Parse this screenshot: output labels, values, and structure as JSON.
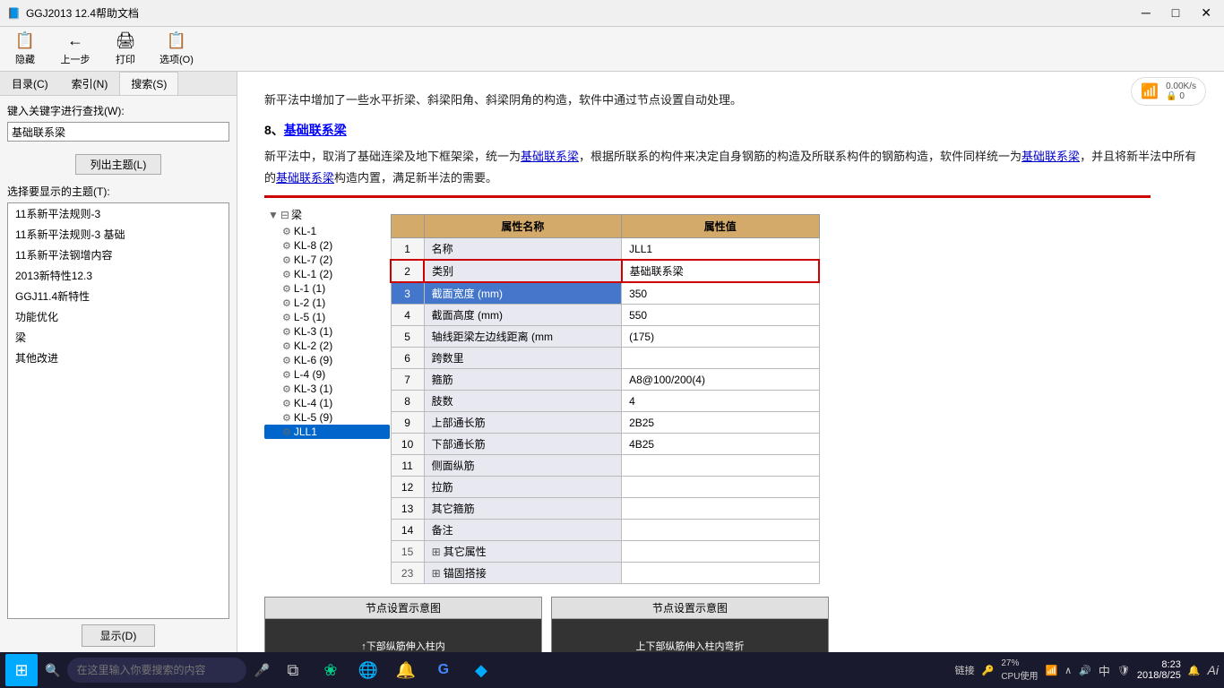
{
  "titleBar": {
    "title": "GGJ2013 12.4帮助文档",
    "controls": [
      "─",
      "□",
      "✕"
    ]
  },
  "toolbar": {
    "buttons": [
      {
        "id": "hide",
        "icon": "📋",
        "label": "隐藏"
      },
      {
        "id": "back",
        "icon": "←",
        "label": "上一步"
      },
      {
        "id": "print",
        "icon": "🖨",
        "label": "打印"
      },
      {
        "id": "options",
        "icon": "📋",
        "label": "选项(O)"
      }
    ]
  },
  "leftPanel": {
    "tabs": [
      {
        "id": "catalog",
        "label": "目录(C)"
      },
      {
        "id": "index",
        "label": "索引(N)"
      },
      {
        "id": "search",
        "label": "搜索(S)",
        "active": true
      }
    ],
    "searchLabel": "键入关键字进行查找(W):",
    "searchValue": "基础联系梁",
    "listTopicBtn": "列出主题(L)",
    "topicSelectLabel": "选择要显示的主题(T):",
    "topics": [
      "11系新平法规则-3",
      "11系新平法规则-3 基础",
      "11系新平法钢增内容",
      "2013新特性12.3",
      "GGJ11.4新特性",
      "功能优化",
      "梁",
      "其他改进"
    ],
    "showBtn": "显示(D)"
  },
  "content": {
    "introText": "新平法中增加了一些水平折梁、斜梁阳角、斜梁阴角的构造，软件中通过节点设置自动处理。",
    "sectionNum": "8、",
    "sectionTitle": "基础联系梁",
    "bodyText1": "新平法中，取消了基础连梁及地下框架梁，统一为",
    "link1": "基础联系梁",
    "bodyText2": "，根据所联系的构件来决定自身钢筋的构造及所联系构件的钢筋构造，软件同样统一为",
    "link2": "基础联系梁",
    "bodyText3": "，并且将新半法中所有的",
    "link3": "基础联系梁",
    "bodyText4": "构造内置，满足新半法的需要。",
    "network": {
      "speed": "0.00K/s",
      "count": "0"
    },
    "table": {
      "headers": [
        "属性名称",
        "属性值"
      ],
      "rows": [
        {
          "num": "1",
          "name": "名称",
          "value": "JLL1",
          "nameLink": true
        },
        {
          "num": "2",
          "name": "类别",
          "value": "基础联系梁",
          "redBorder": true
        },
        {
          "num": "3",
          "name": "截面宽度 (mm)",
          "value": "350",
          "selected": true
        },
        {
          "num": "4",
          "name": "截面高度 (mm)",
          "value": "550"
        },
        {
          "num": "5",
          "name": "轴线距梁左边线距离 (mm",
          "value": "(175)"
        },
        {
          "num": "6",
          "name": "跨数里",
          "value": ""
        },
        {
          "num": "7",
          "name": "箍筋",
          "value": "A8@100/200(4)"
        },
        {
          "num": "8",
          "name": "肢数",
          "value": "4"
        },
        {
          "num": "9",
          "name": "上部通长筋",
          "value": "2B25"
        },
        {
          "num": "10",
          "name": "下部通长筋",
          "value": "4B25"
        },
        {
          "num": "11",
          "name": "侧面纵筋",
          "value": "",
          "nameLink": true
        },
        {
          "num": "12",
          "name": "拉筋",
          "value": "",
          "nameLink": true
        },
        {
          "num": "13",
          "name": "其它箍筋",
          "value": "",
          "nameLink": true
        },
        {
          "num": "14",
          "name": "备注",
          "value": ""
        },
        {
          "num": "15",
          "name": "其它属性",
          "value": "",
          "expand": true
        },
        {
          "num": "23",
          "name": "锚固搭接",
          "value": "",
          "expand": true
        }
      ]
    },
    "tree": {
      "root": "梁",
      "items": [
        {
          "label": "KL-1",
          "indent": 1
        },
        {
          "label": "KL-8 (2)",
          "indent": 1
        },
        {
          "label": "KL-7 (2)",
          "indent": 1
        },
        {
          "label": "KL-1 (2)",
          "indent": 1
        },
        {
          "label": "L-1 (1)",
          "indent": 1
        },
        {
          "label": "L-2 (1)",
          "indent": 1
        },
        {
          "label": "L-5 (1)",
          "indent": 1
        },
        {
          "label": "KL-3 (1)",
          "indent": 1
        },
        {
          "label": "KL-2 (2)",
          "indent": 1
        },
        {
          "label": "KL-6 (9)",
          "indent": 1
        },
        {
          "label": "L-4 (9)",
          "indent": 1
        },
        {
          "label": "KL-3 (1)",
          "indent": 1
        },
        {
          "label": "KL-4 (1)",
          "indent": 1
        },
        {
          "label": "KL-5 (9)",
          "indent": 1
        },
        {
          "label": "JLL1",
          "indent": 1,
          "selected": true
        }
      ]
    },
    "bottomPanels": [
      {
        "title": "节点设置示意图",
        "label": "↑下部纵筋伸入柱内"
      },
      {
        "title": "节点设置示意图",
        "label": "上下部纵筋伸入柱内弯折"
      }
    ]
  },
  "taskbar": {
    "searchPlaceholder": "在这里输入你要搜索的内容",
    "apps": [
      "⊞",
      "🔍",
      "🔄",
      "🌐",
      "🔔",
      "G",
      "🔷"
    ],
    "rightItems": {
      "link": "链接",
      "cpuLabel": "27%\nCPU使用",
      "time": "8:23",
      "date": "2018/8/25",
      "lang": "中",
      "notification": "🔔"
    }
  }
}
